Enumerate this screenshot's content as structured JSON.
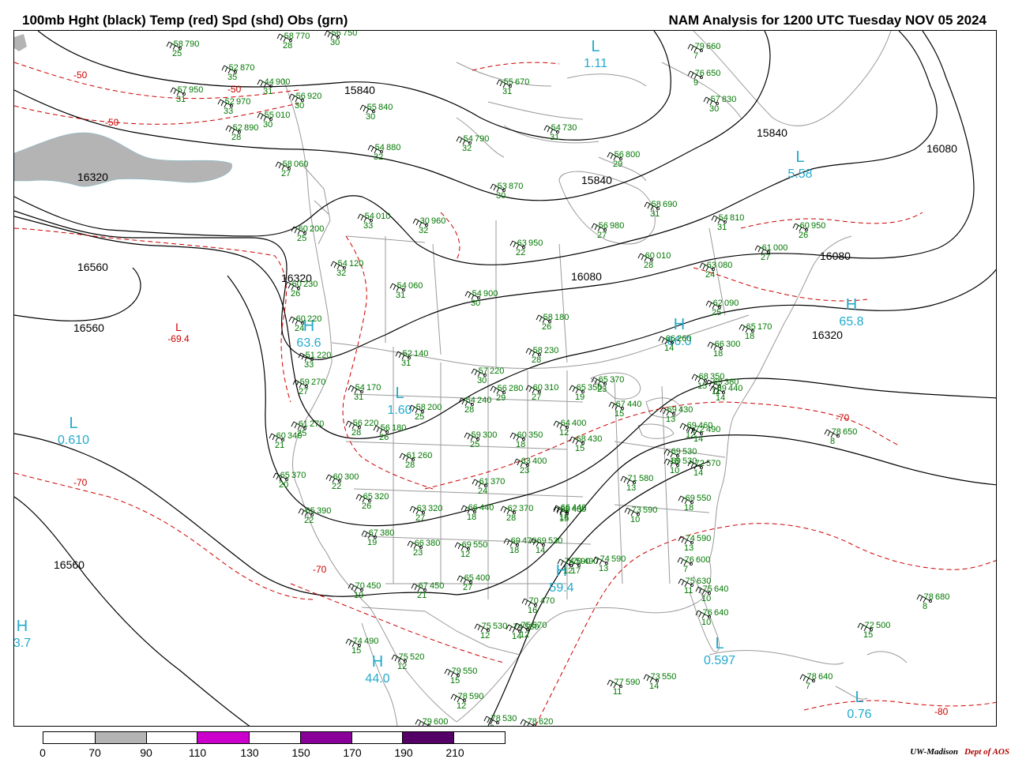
{
  "header": {
    "left_title": "100mb Hght (black) Temp (red) Spd (shd) Obs (grn)",
    "right_title": "NAM Analysis for 1200 UTC Tuesday  NOV 05 2024"
  },
  "colors": {
    "height_contour": "#000000",
    "temp_contour": "#cc0000",
    "obs": "#007700",
    "center_label": "#22aacc",
    "map_lines": "#999999",
    "speed_70_90": "#b4b4b4",
    "speed_110_130": "#cc00cc",
    "speed_150_170": "#880099",
    "speed_190_210": "#550066"
  },
  "height_labels": [
    "15840",
    "15840",
    "15840",
    "16080",
    "16080",
    "16080",
    "16320",
    "16320",
    "16320",
    "16560",
    "16560",
    "16560"
  ],
  "temp_labels": [
    "-50",
    "-50",
    "-50",
    "-70",
    "-70",
    "-70",
    "-80"
  ],
  "centers": [
    {
      "letter": "L",
      "value": "1.11"
    },
    {
      "letter": "L",
      "value": "5.58"
    },
    {
      "letter": "H",
      "value": "65.8"
    },
    {
      "letter": "H",
      "value": "66.0"
    },
    {
      "letter": "H",
      "value": "63.6"
    },
    {
      "letter": "L",
      "value": "1.60"
    },
    {
      "letter": "L",
      "value": "0.610"
    },
    {
      "letter": "H",
      "value": "59.4"
    },
    {
      "letter": "L",
      "value": "0.597"
    },
    {
      "letter": "H",
      "value": "3.7"
    },
    {
      "letter": "H",
      "value": "44.0"
    },
    {
      "letter": "L",
      "value": "0.76"
    }
  ],
  "temp_centers": [
    {
      "letter": "L",
      "value": "-69.4"
    }
  ],
  "observations": [
    {
      "t": "-58",
      "h": "790",
      "s": "25"
    },
    {
      "t": "-58",
      "h": "770",
      "s": "28"
    },
    {
      "t": "-56",
      "h": "750",
      "s": "30"
    },
    {
      "t": "-52",
      "h": "870",
      "s": "35"
    },
    {
      "t": "-44",
      "h": "900",
      "s": "31"
    },
    {
      "t": "-57",
      "h": "950",
      "s": "31"
    },
    {
      "t": "-52",
      "h": "970",
      "s": "33"
    },
    {
      "t": "-56",
      "h": "920",
      "s": "30"
    },
    {
      "t": "-55",
      "h": "010",
      "s": "30"
    },
    {
      "t": "-52",
      "h": "890",
      "s": "28"
    },
    {
      "t": "-55",
      "h": "840",
      "s": "30"
    },
    {
      "t": "-54",
      "h": "880",
      "s": "32"
    },
    {
      "t": "-58",
      "h": "060",
      "s": "27"
    },
    {
      "t": "-54",
      "h": "010",
      "s": "33"
    },
    {
      "t": "-30",
      "h": "960",
      "s": "32"
    },
    {
      "t": "-60",
      "h": "200",
      "s": "25"
    },
    {
      "t": "-54",
      "h": "120",
      "s": "32"
    },
    {
      "t": "-60",
      "h": "230",
      "s": "26"
    },
    {
      "t": "-54",
      "h": "060",
      "s": "31"
    },
    {
      "t": "-60",
      "h": "220",
      "s": "24"
    },
    {
      "t": "-51",
      "h": "220",
      "s": "33"
    },
    {
      "t": "-52",
      "h": "140",
      "s": "31"
    },
    {
      "t": "-59",
      "h": "270",
      "s": "27"
    },
    {
      "t": "-54",
      "h": "170",
      "s": "31"
    },
    {
      "t": "-58",
      "h": "200",
      "s": "25"
    },
    {
      "t": "-54",
      "h": "240",
      "s": "28"
    },
    {
      "t": "-61",
      "h": "270",
      "s": "25"
    },
    {
      "t": "-56",
      "h": "220",
      "s": "28"
    },
    {
      "t": "-56",
      "h": "180",
      "s": "26"
    },
    {
      "t": "-60",
      "h": "340",
      "s": "21"
    },
    {
      "t": "-61",
      "h": "260",
      "s": "28"
    },
    {
      "t": "-65",
      "h": "370",
      "s": "20"
    },
    {
      "t": "-60",
      "h": "300",
      "s": "22"
    },
    {
      "t": "-65",
      "h": "320",
      "s": "26"
    },
    {
      "t": "-65",
      "h": "390",
      "s": "22"
    },
    {
      "t": "-63",
      "h": "320",
      "s": "27"
    },
    {
      "t": "-67",
      "h": "380",
      "s": "19"
    },
    {
      "t": "-66",
      "h": "380",
      "s": "23"
    },
    {
      "t": "-70",
      "h": "450",
      "s": "19"
    },
    {
      "t": "-67",
      "h": "450",
      "s": "21"
    },
    {
      "t": "-74",
      "h": "490",
      "s": "15"
    },
    {
      "t": "-75",
      "h": "520",
      "s": "12"
    },
    {
      "t": "-79",
      "h": "550",
      "s": "15"
    },
    {
      "t": "-78",
      "h": "590",
      "s": "12"
    },
    {
      "t": "-79",
      "h": "600",
      "s": "12"
    },
    {
      "t": "-78",
      "h": "530",
      "s": "9"
    },
    {
      "t": "-78",
      "h": "620",
      "s": "9"
    },
    {
      "t": "-54",
      "h": "790",
      "s": "32"
    },
    {
      "t": "-53",
      "h": "870",
      "s": "30"
    },
    {
      "t": "-55",
      "h": "670",
      "s": "31"
    },
    {
      "t": "-54",
      "h": "730",
      "s": "31"
    },
    {
      "t": "-56",
      "h": "800",
      "s": "29"
    },
    {
      "t": "-63",
      "h": "950",
      "s": "22"
    },
    {
      "t": "-56",
      "h": "980",
      "s": "27"
    },
    {
      "t": "-54",
      "h": "900",
      "s": "30"
    },
    {
      "t": "-58",
      "h": "180",
      "s": "26"
    },
    {
      "t": "-58",
      "h": "230",
      "s": "28"
    },
    {
      "t": "-57",
      "h": "220",
      "s": "30"
    },
    {
      "t": "-56",
      "h": "280",
      "s": "29"
    },
    {
      "t": "-60",
      "h": "310",
      "s": "27"
    },
    {
      "t": "-65",
      "h": "350",
      "s": "19"
    },
    {
      "t": "-65",
      "h": "370",
      "s": "23"
    },
    {
      "t": "-67",
      "h": "440",
      "s": "15"
    },
    {
      "t": "-59",
      "h": "300",
      "s": "25"
    },
    {
      "t": "-60",
      "h": "350",
      "s": "18"
    },
    {
      "t": "-64",
      "h": "400",
      "s": "12"
    },
    {
      "t": "-68",
      "h": "430",
      "s": "15"
    },
    {
      "t": "-63",
      "h": "400",
      "s": "23"
    },
    {
      "t": "-61",
      "h": "370",
      "s": "24"
    },
    {
      "t": "-66",
      "h": "440",
      "s": "18"
    },
    {
      "t": "-62",
      "h": "370",
      "s": "28"
    },
    {
      "t": "-66",
      "h": "440",
      "s": "18"
    },
    {
      "t": "-68",
      "h": "480",
      "s": "15"
    },
    {
      "t": "-69",
      "h": "470",
      "s": "18"
    },
    {
      "t": "-69",
      "h": "530",
      "s": "14"
    },
    {
      "t": "-70",
      "h": "490",
      "s": "17"
    },
    {
      "t": "-69",
      "h": "550",
      "s": "12"
    },
    {
      "t": "-65",
      "h": "400",
      "s": "27"
    },
    {
      "t": "-70",
      "h": "470",
      "s": "16"
    },
    {
      "t": "-75",
      "h": "530",
      "s": "12"
    },
    {
      "t": "-74",
      "h": "530",
      "s": "14"
    },
    {
      "t": "-75",
      "h": "570",
      "s": "12"
    },
    {
      "t": "-74",
      "h": "590",
      "s": "13"
    },
    {
      "t": "-74",
      "h": "590",
      "s": "12"
    },
    {
      "t": "-77",
      "h": "590",
      "s": "11"
    },
    {
      "t": "-73",
      "h": "550",
      "s": "14"
    },
    {
      "t": "-79",
      "h": "660",
      "s": "7"
    },
    {
      "t": "-76",
      "h": "650",
      "s": "9"
    },
    {
      "t": "-57",
      "h": "830",
      "s": "30"
    },
    {
      "t": "-58",
      "h": "690",
      "s": "31"
    },
    {
      "t": "-54",
      "h": "810",
      "s": "31"
    },
    {
      "t": "-60",
      "h": "950",
      "s": "26"
    },
    {
      "t": "-61",
      "h": "000",
      "s": "27"
    },
    {
      "t": "-60",
      "h": "010",
      "s": "28"
    },
    {
      "t": "-63",
      "h": "080",
      "s": "24"
    },
    {
      "t": "-62",
      "h": "090",
      "s": "25"
    },
    {
      "t": "-65",
      "h": "170",
      "s": "18"
    },
    {
      "t": "-66",
      "h": "260",
      "s": "14"
    },
    {
      "t": "-66",
      "h": "300",
      "s": "18"
    },
    {
      "t": "-68",
      "h": "350",
      "s": "15"
    },
    {
      "t": "-69",
      "h": "380",
      "s": "11"
    },
    {
      "t": "-69",
      "h": "440",
      "s": "14"
    },
    {
      "t": "-69",
      "h": "430",
      "s": "13"
    },
    {
      "t": "-69",
      "h": "460",
      "s": "12"
    },
    {
      "t": "-72",
      "h": "490",
      "s": "14"
    },
    {
      "t": "-69",
      "h": "530",
      "s": "18"
    },
    {
      "t": "-69",
      "h": "530",
      "s": "10"
    },
    {
      "t": "-72",
      "h": "570",
      "s": "14"
    },
    {
      "t": "-71",
      "h": "580",
      "s": "13"
    },
    {
      "t": "-73",
      "h": "590",
      "s": "10"
    },
    {
      "t": "-69",
      "h": "550",
      "s": "18"
    },
    {
      "t": "-74",
      "h": "590",
      "s": "13"
    },
    {
      "t": "-76",
      "h": "600",
      "s": "7"
    },
    {
      "t": "-75",
      "h": "630",
      "s": "11"
    },
    {
      "t": "-75",
      "h": "640",
      "s": "10"
    },
    {
      "t": "-76",
      "h": "640",
      "s": "10"
    },
    {
      "t": "-78",
      "h": "650",
      "s": "8"
    },
    {
      "t": "-78",
      "h": "680",
      "s": "8"
    },
    {
      "t": "-72",
      "h": "500",
      "s": "15"
    },
    {
      "t": "-78",
      "h": "640",
      "s": "7"
    },
    {
      "t": "-77",
      "h": "620",
      "s": "7"
    },
    {
      "t": "-76",
      "h": "640",
      "s": "8"
    }
  ],
  "colorbar": {
    "ticks": [
      "0",
      "70",
      "90",
      "110",
      "130",
      "150",
      "170",
      "190",
      "210"
    ]
  },
  "credit": {
    "org": "UW-Madison",
    "dept": "Dept of AOS"
  }
}
